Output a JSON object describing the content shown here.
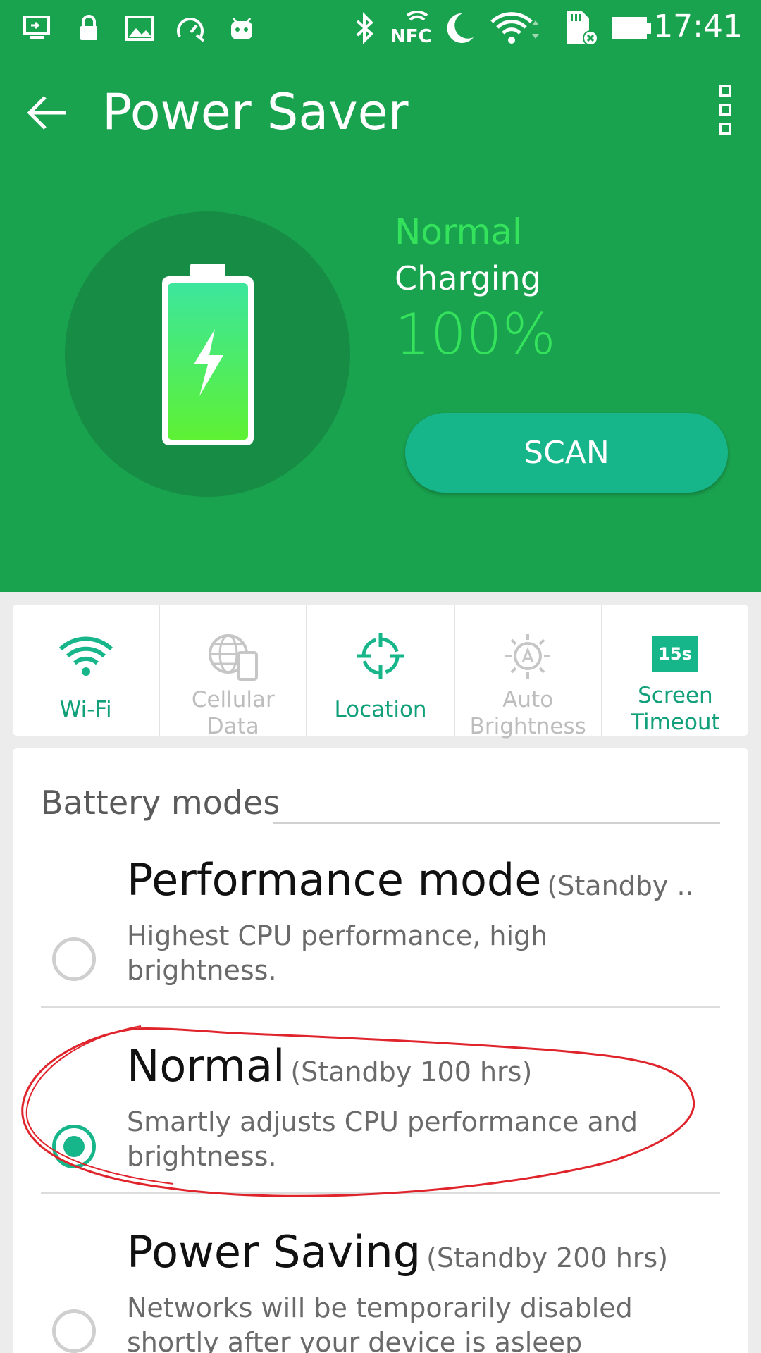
{
  "status_bar": {
    "time": "17:41",
    "icons": [
      "screen-cast-icon",
      "lock-icon",
      "image-icon",
      "speed-icon",
      "android-icon",
      "bluetooth-icon",
      "nfc-icon",
      "moon-icon",
      "wifi-icon",
      "sd-card-icon",
      "battery-icon"
    ],
    "nfc_text": "NFC"
  },
  "app_bar": {
    "title": "Power Saver"
  },
  "battery": {
    "mode": "Normal",
    "state": "Charging",
    "percent": "100%",
    "level": 1.0,
    "scan_label": "SCAN"
  },
  "toggles": [
    {
      "label": "Wi-Fi",
      "icon": "wifi-icon",
      "active": true
    },
    {
      "label": "Cellular Data",
      "icon": "globe-phone-icon",
      "active": false
    },
    {
      "label": "Location",
      "icon": "location-target-icon",
      "active": true
    },
    {
      "label": "Auto Brightness",
      "icon": "auto-brightness-icon",
      "active": false
    },
    {
      "label": "Screen Timeout",
      "icon": "timeout-icon",
      "badge": "15s",
      "active": true
    }
  ],
  "battery_modes": {
    "heading": "Battery modes",
    "items": [
      {
        "name": "Performance mode",
        "standby": "(Standby ..",
        "description": "Highest CPU performance, high brightness.",
        "selected": false
      },
      {
        "name": "Normal",
        "standby": "(Standby 100 hrs)",
        "description": "Smartly adjusts CPU performance and brightness.",
        "selected": true
      },
      {
        "name": "Power Saving",
        "standby": "(Standby 200 hrs)",
        "description": "Networks will be temporarily disabled shortly after your device is asleep",
        "selected": false
      }
    ]
  },
  "colors": {
    "header_green": "#1aa34f",
    "accent_teal": "#16b58a",
    "bright_green": "#35e25c",
    "annotation_red": "#e0242c"
  }
}
